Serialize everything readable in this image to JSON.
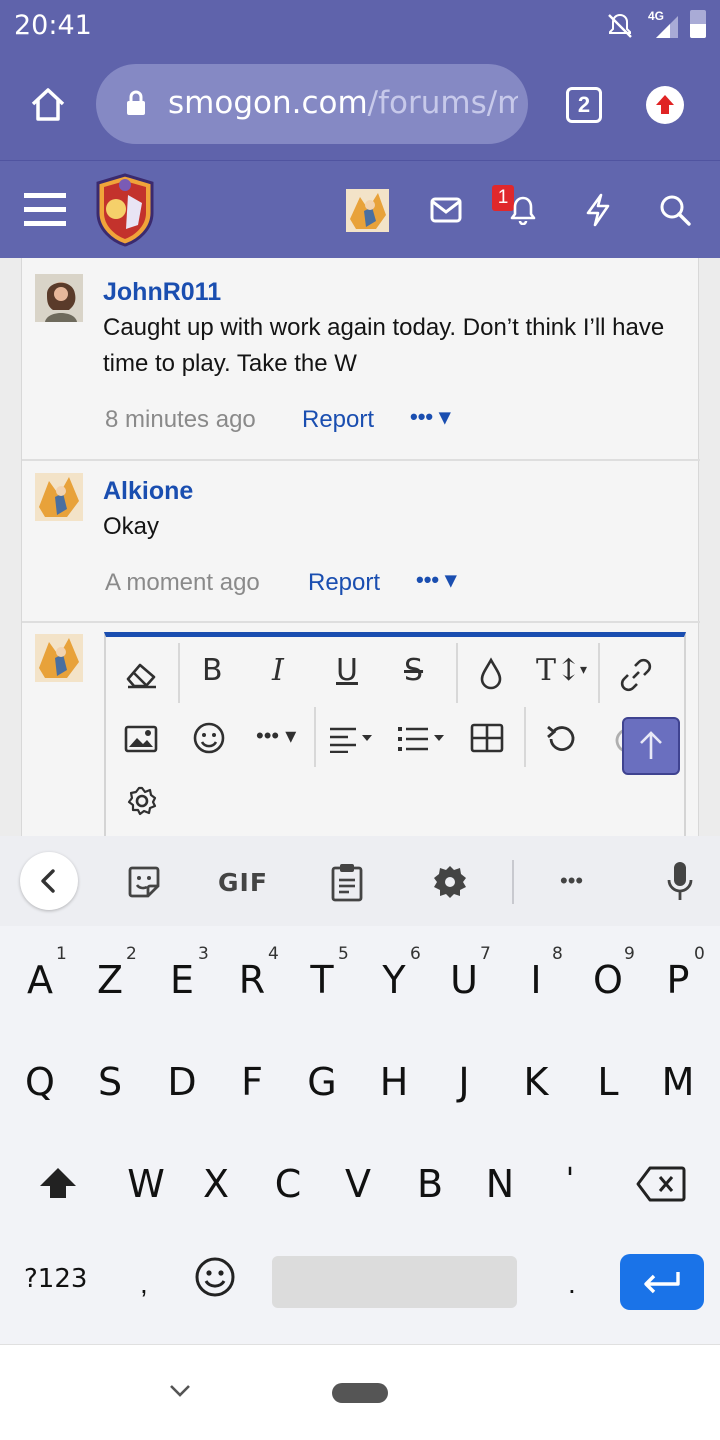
{
  "status": {
    "time": "20:41",
    "network": "4G"
  },
  "browser": {
    "url_domain": "smogon.com",
    "url_path": "/forums/m",
    "tabs_count": "2"
  },
  "site": {
    "notif_count": "1"
  },
  "comments": [
    {
      "user": "JohnR011",
      "text": "Caught up with work again today. Don’t think I’ll have time to play. Take the W",
      "time": "8 minutes ago",
      "report": "Report"
    },
    {
      "user": "Alkione",
      "text": "Okay",
      "time": "A moment ago",
      "report": "Report"
    }
  ],
  "editor": {
    "bold": "B",
    "italic": "I",
    "underline": "U",
    "strike": "S",
    "textsize": "T↕"
  },
  "keyboard": {
    "toolbar": {
      "gif": "GIF",
      "more": "•••"
    },
    "row1": [
      "A",
      "Z",
      "E",
      "R",
      "T",
      "Y",
      "U",
      "I",
      "O",
      "P"
    ],
    "row1_hints": [
      "1",
      "2",
      "3",
      "4",
      "5",
      "6",
      "7",
      "8",
      "9",
      "0"
    ],
    "row2": [
      "Q",
      "S",
      "D",
      "F",
      "G",
      "H",
      "J",
      "K",
      "L",
      "M"
    ],
    "row3": [
      "W",
      "X",
      "C",
      "V",
      "B",
      "N",
      "'"
    ],
    "symbols": "?123",
    "comma": ",",
    "period": "."
  }
}
